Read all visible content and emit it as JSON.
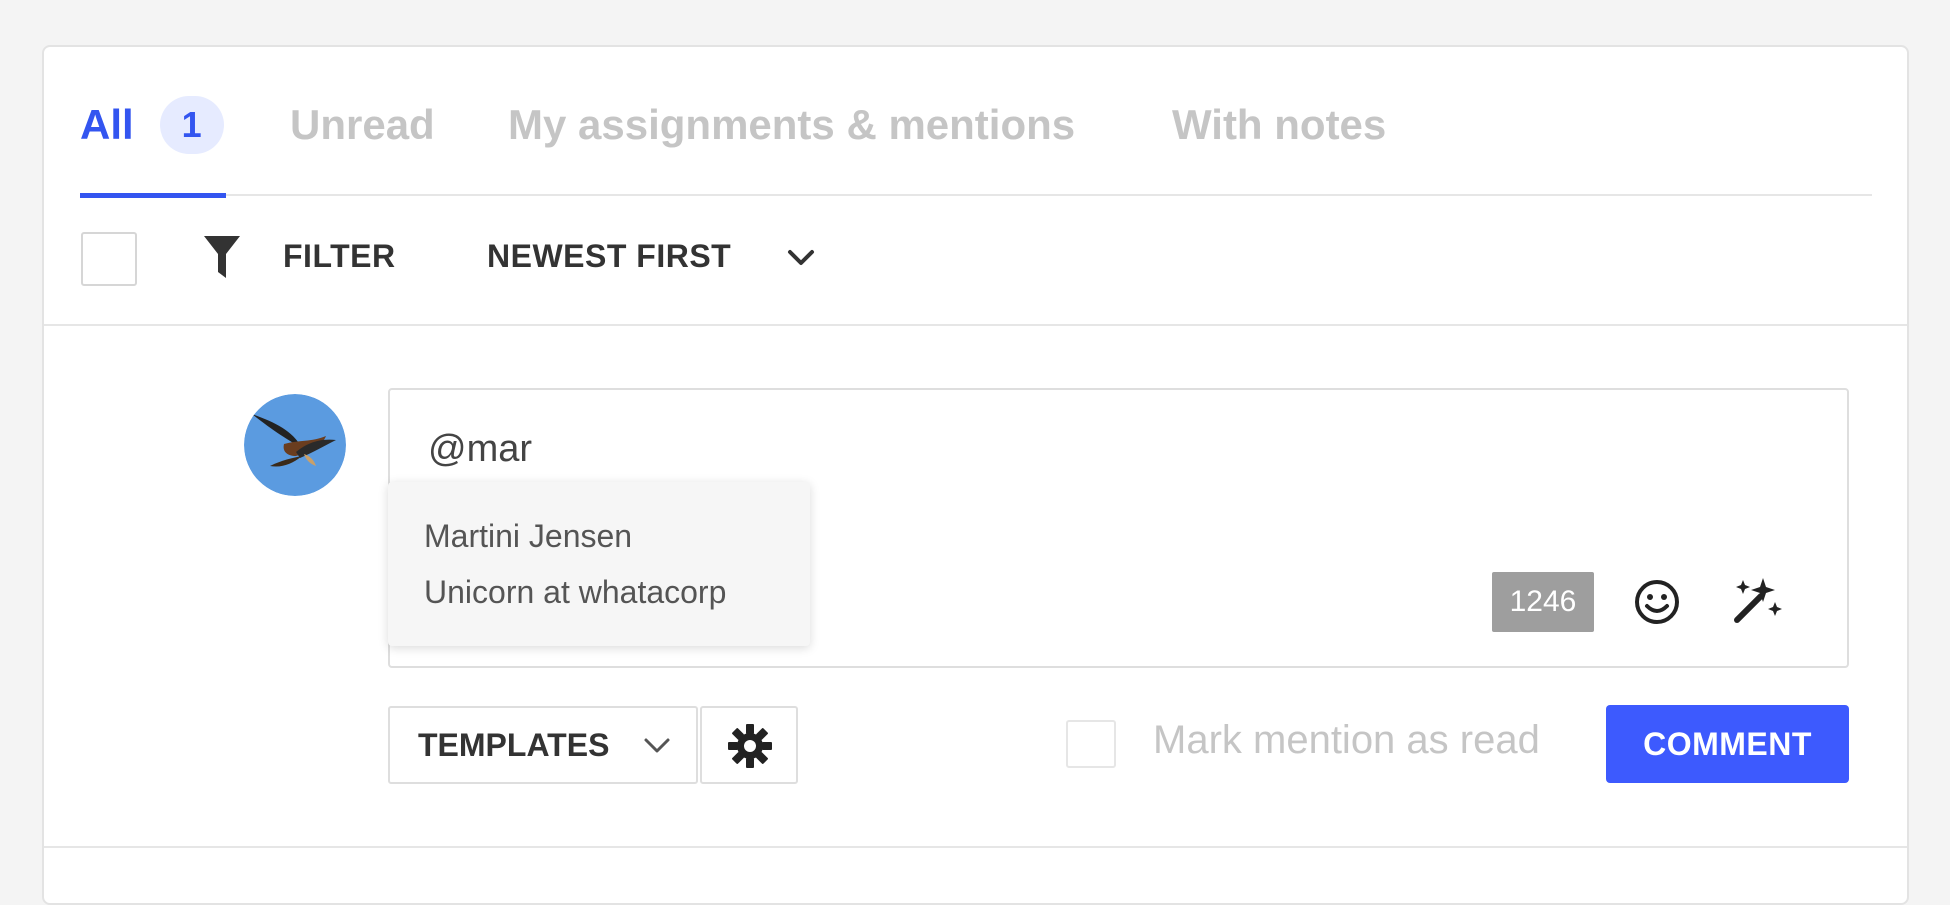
{
  "tabs": [
    {
      "label": "All",
      "badge": "1",
      "active": true
    },
    {
      "label": "Unread"
    },
    {
      "label": "My assignments & mentions"
    },
    {
      "label": "With notes"
    }
  ],
  "toolbar": {
    "filter_label": "FILTER",
    "sort_label": "NEWEST FIRST"
  },
  "composer": {
    "text": "@mar",
    "char_count": "1246",
    "mention_suggestion": {
      "name": "Martini Jensen",
      "role": "Unicorn at whatacorp"
    },
    "templates_label": "TEMPLATES",
    "mark_mention_label": "Mark mention as read",
    "comment_label": "COMMENT"
  },
  "colors": {
    "accent": "#3355f0",
    "button": "#3d5afe",
    "inactive_tab": "#c5c5c5",
    "badge_bg": "#e6ebff",
    "counter_bg": "#9e9e9e"
  },
  "icons": {
    "filter": "filter-funnel-icon",
    "sort_chevron": "chevron-down-icon",
    "emoji": "smiley-face-icon",
    "ai": "magic-wand-sparkles-icon",
    "templates_chevron": "chevron-down-icon",
    "settings": "gear-icon"
  }
}
